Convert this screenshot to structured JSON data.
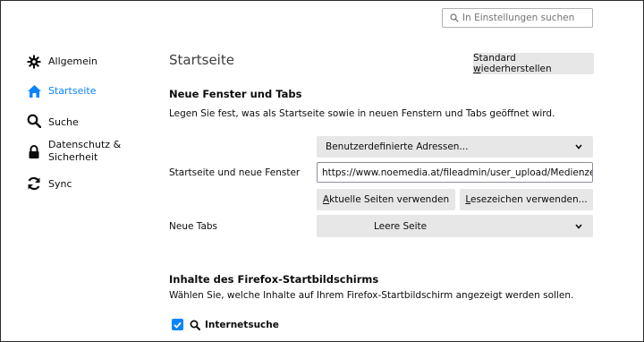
{
  "search": {
    "placeholder": "In Einstellungen suchen"
  },
  "sidebar": {
    "items": [
      {
        "label": "Allgemein",
        "icon": "gear-icon"
      },
      {
        "label": "Startseite",
        "icon": "home-icon",
        "selected": true
      },
      {
        "label": "Suche",
        "icon": "search-icon"
      },
      {
        "label_line1": "Datenschutz &",
        "label_line2": "Sicherheit",
        "icon": "lock-icon"
      },
      {
        "label": "Sync",
        "icon": "sync-icon"
      }
    ]
  },
  "main": {
    "page_title": "Startseite",
    "restore_button": {
      "before": "Standard ",
      "accel": "w",
      "after": "iederherstellen"
    },
    "section1": {
      "title": "Neue Fenster und Tabs",
      "description": "Legen Sie fest, was als Startseite sowie in neuen Fenstern und Tabs geöffnet wird.",
      "homepage_select": "Benutzerdefinierte Adressen...",
      "homepage_label": "Startseite und neue Fenster",
      "homepage_url": "https://www.noemedia.at/fileadmin/user_upload/Medienzentru",
      "use_current": {
        "accel": "A",
        "rest": "ktuelle Seiten verwenden"
      },
      "use_bookmark": {
        "accel": "L",
        "rest": "esezeichen verwenden..."
      },
      "newtabs_label": "Neue Tabs",
      "newtabs_select": "Leere Seite"
    },
    "section2": {
      "title": "Inhalte des Firefox-Startbildschirms",
      "description": "Wählen Sie, welche Inhalte auf Ihrem Firefox-Startbildschirm angezeigt werden sollen.",
      "websearch_label": "Internetsuche",
      "websearch_checked": true
    }
  },
  "colors": {
    "accent": "#0a84ff",
    "button_bg": "#e7e7e8"
  }
}
